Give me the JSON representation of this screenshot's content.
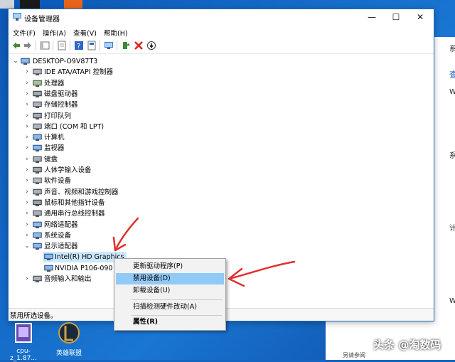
{
  "window": {
    "title": "设备管理器",
    "controls": {
      "minimize": "—",
      "maximize": "☐",
      "close": "✕"
    }
  },
  "menubar": [
    "文件(F)",
    "操作(A)",
    "查看(V)",
    "帮助(H)"
  ],
  "tree": {
    "root": "DESKTOP-O9V87T3",
    "categories": [
      {
        "label": "IDE ATA/ATAPI 控制器",
        "icon": "ide-controller-icon"
      },
      {
        "label": "处理器",
        "icon": "processor-icon"
      },
      {
        "label": "磁盘驱动器",
        "icon": "disk-drive-icon"
      },
      {
        "label": "存储控制器",
        "icon": "storage-controller-icon"
      },
      {
        "label": "打印队列",
        "icon": "printer-icon"
      },
      {
        "label": "端口 (COM 和 LPT)",
        "icon": "port-icon"
      },
      {
        "label": "计算机",
        "icon": "computer-icon"
      },
      {
        "label": "监视器",
        "icon": "monitor-icon"
      },
      {
        "label": "键盘",
        "icon": "keyboard-icon"
      },
      {
        "label": "人体学输入设备",
        "icon": "hid-icon"
      },
      {
        "label": "软件设备",
        "icon": "software-device-icon"
      },
      {
        "label": "声音、视频和游戏控制器",
        "icon": "sound-icon"
      },
      {
        "label": "鼠标和其他指针设备",
        "icon": "mouse-icon"
      },
      {
        "label": "通用串行总线控制器",
        "icon": "usb-icon"
      },
      {
        "label": "网络适配器",
        "icon": "network-icon"
      },
      {
        "label": "系统设备",
        "icon": "system-device-icon"
      },
      {
        "label": "显示适配器",
        "icon": "display-adapter-icon",
        "expanded": true
      }
    ],
    "display_children": [
      "Intel(R) HD Graphics",
      "NVIDIA P106-090"
    ],
    "after": {
      "label": "音频输入和输出",
      "icon": "audio-io-icon"
    }
  },
  "status": "禁用所选设备。",
  "context_menu": {
    "items": [
      "更新驱动程序(P)",
      "禁用设备(D)",
      "卸载设备(U)",
      "扫描检测硬件改动(A)",
      "属性(R)"
    ],
    "highlighted_index": 1
  },
  "desktop": {
    "icons": [
      {
        "label": "cpu-z_1.87...",
        "icon": "cpu-z-icon"
      },
      {
        "label": "英雄联盟",
        "icon": "league-icon"
      }
    ]
  },
  "background_window": {
    "lines": [
      "系",
      "查",
      "W",
      "系",
      "计",
      "W"
    ]
  },
  "watermark": "头条 @淘数码",
  "watermark_sub": "另请参阅",
  "colors": {
    "selection": "#cce8ff",
    "menu_highlight": "#91c9f7",
    "arrow": "#e0312e"
  }
}
